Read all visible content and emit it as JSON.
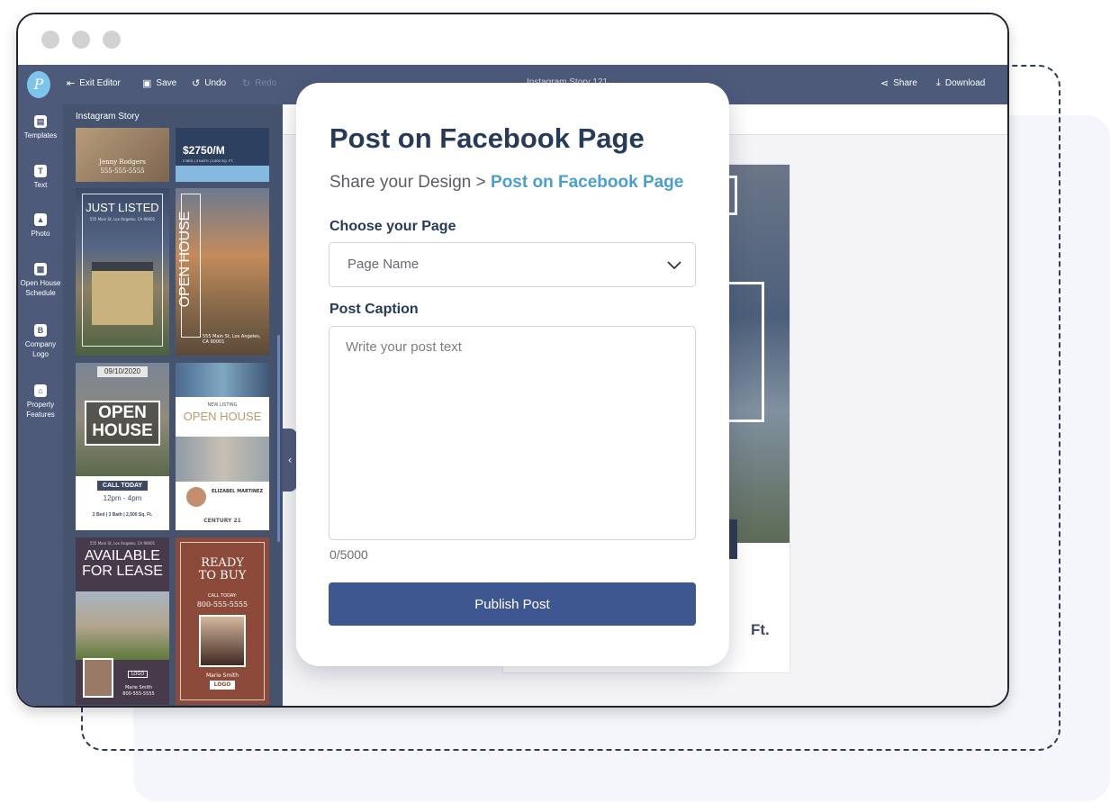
{
  "window": {
    "chrome_dots": 3
  },
  "toolbar": {
    "logo_letter": "P",
    "exit_label": "Exit Editor",
    "save_label": "Save",
    "undo_label": "Undo",
    "redo_label": "Redo",
    "doc_title": "Instagram Story 121",
    "share_label": "Share",
    "download_label": "Download"
  },
  "sidebar": {
    "tabs": [
      {
        "label": "Templates",
        "icon": "templates-icon"
      },
      {
        "label": "Text",
        "icon": "text-icon"
      },
      {
        "label": "Photo",
        "icon": "photo-icon"
      },
      {
        "label": "Open House Schedule",
        "icon": "calendar-icon"
      },
      {
        "label": "Company Logo",
        "icon": "logo-b-icon"
      },
      {
        "label": "Property Features",
        "icon": "house-icon"
      }
    ]
  },
  "templates": {
    "title": "Instagram Story",
    "cards": [
      {
        "line1": "Jenny Rodgers",
        "line2": "555-555-5555"
      },
      {
        "price": "$2750/M",
        "details": "2 BED | 3 BATH | 2,500 SQ. FT."
      },
      {
        "headline": "JUST LISTED",
        "sub": "555 Main St, Los Angeles, CA 90001"
      },
      {
        "headline": "OPEN HOUSE",
        "sub": "555 Main St, Los Angeles, CA 90001"
      },
      {
        "date": "09/10/2020",
        "headline1": "OPEN",
        "headline2": "HOUSE",
        "cta": "CALL TODAY",
        "time": "12pm - 4pm",
        "details": "2 Bed | 3 Bath | 2,500 Sq. Ft."
      },
      {
        "kicker": "NEW LISTING",
        "headline": "OPEN HOUSE",
        "agent": "ELIZABEL MARTINEZ",
        "brand": "CENTURY 21"
      },
      {
        "address": "555 Main St, Los Angeles, CA 90001",
        "headline1": "AVAILABLE",
        "headline2": "FOR LEASE",
        "logo": "LOGO",
        "agent": "Marie Smith",
        "phone": "800-555-5555"
      },
      {
        "headline1": "READY",
        "headline2": "TO BUY",
        "cta": "CALL TODAY:",
        "phone": "800-555-5555",
        "agent": "Marie Smith",
        "logo": "LOGO"
      }
    ]
  },
  "canvas": {
    "preview_text": "Ft."
  },
  "modal": {
    "title": "Post on Facebook Page",
    "breadcrumb_parent": "Share your Design >",
    "breadcrumb_current": "Post on Facebook Page",
    "page_label": "Choose your Page",
    "page_select_value": "Page Name",
    "caption_label": "Post Caption",
    "caption_placeholder": "Write your post text",
    "caption_counter": "0/5000",
    "publish_label": "Publish Post"
  },
  "colors": {
    "toolbar_bg": "#4d5a7a",
    "panel_bg": "#46536f",
    "accent": "#4a9ed1",
    "publish_bg": "#3f5791",
    "title_color": "#263a5a"
  }
}
